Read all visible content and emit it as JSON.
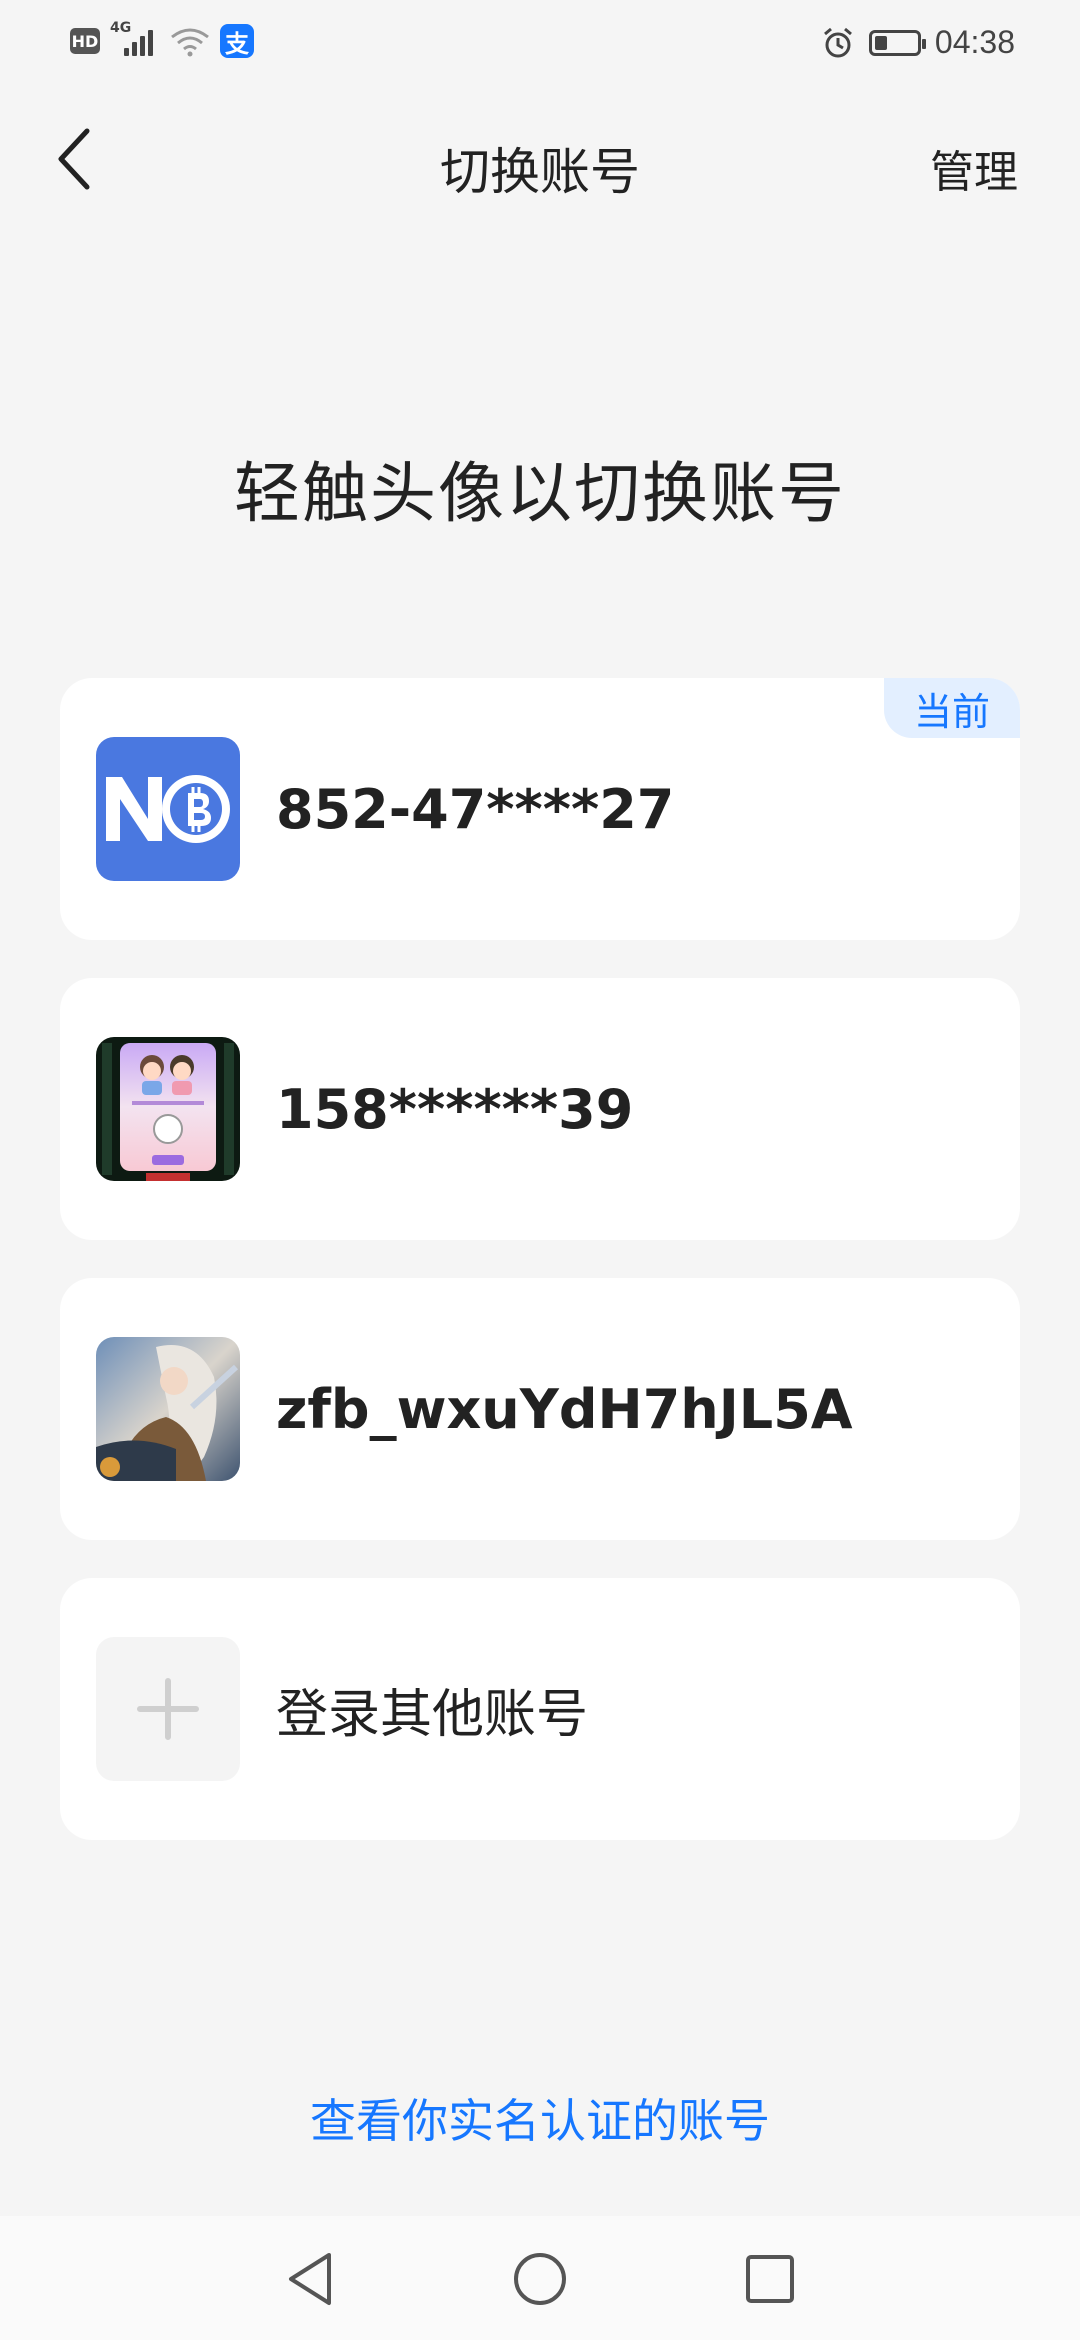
{
  "status_bar": {
    "hd": "HD",
    "network": "4G",
    "app_icon_char": "支",
    "time": "04:38",
    "icons": [
      "hd-icon",
      "signal-icon",
      "wifi-icon",
      "alipay-icon",
      "alarm-icon",
      "battery-icon"
    ]
  },
  "header": {
    "title": "切换账号",
    "manage": "管理",
    "back_icon": "chevron-left-icon"
  },
  "prompt": "轻触头像以切换账号",
  "accounts": [
    {
      "name": "852-47****27",
      "badge": "当前",
      "avatar": "no-bitcoin-logo-avatar"
    },
    {
      "name": "158******39",
      "avatar": "cartoon-couple-avatar"
    },
    {
      "name": "zfb_wxuYdH7hJL5A",
      "avatar": "game-hero-avatar"
    }
  ],
  "add_account": {
    "label": "登录其他账号",
    "icon": "plus-icon"
  },
  "verify_link": "查看你实名认证的账号",
  "nav_bar": {
    "icons": [
      "back-triangle-icon",
      "home-circle-icon",
      "recents-square-icon"
    ]
  },
  "colors": {
    "accent": "#1677ff",
    "background": "#f5f5f5",
    "card": "#ffffff",
    "badge_bg": "#e3efff"
  }
}
